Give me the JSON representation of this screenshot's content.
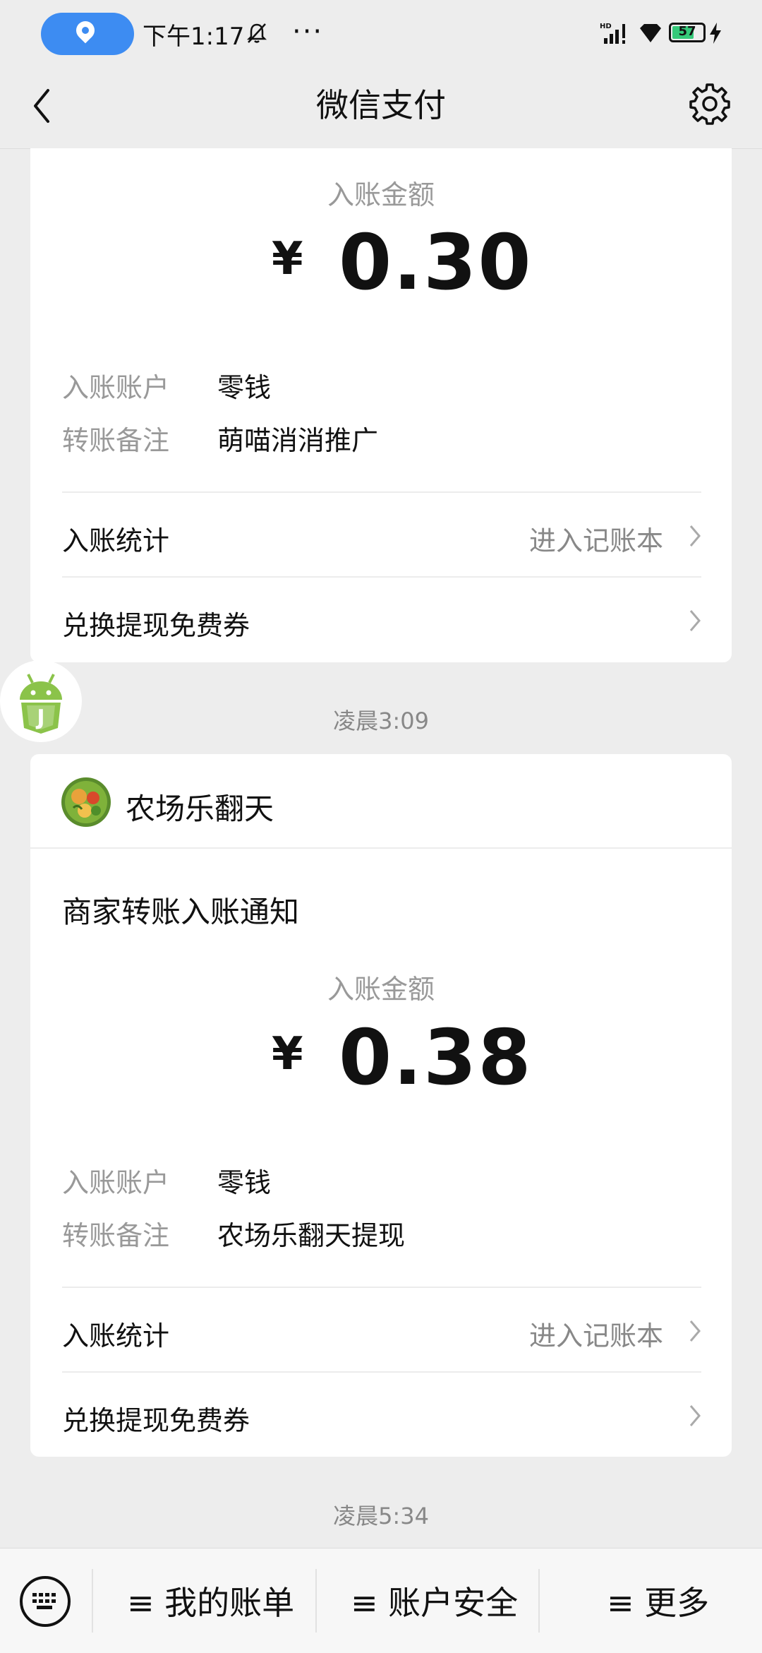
{
  "status_bar": {
    "time": "下午1:17",
    "more": "···",
    "battery": "57"
  },
  "nav": {
    "title": "微信支付"
  },
  "card1": {
    "amount_label": "入账金额",
    "currency": "¥",
    "amount": "0.30",
    "account_label": "入账账户",
    "account_value": "零钱",
    "remark_label": "转账备注",
    "remark_value": "萌喵消消推广",
    "stats_label": "入账统计",
    "stats_link": "进入记账本",
    "coupon_label": "兑换提现免费券"
  },
  "timestamp1": "凌晨3:09",
  "card2": {
    "merchant": "农场乐翻天",
    "notice": "商家转账入账通知",
    "amount_label": "入账金额",
    "currency": "¥",
    "amount": "0.38",
    "account_label": "入账账户",
    "account_value": "零钱",
    "remark_label": "转账备注",
    "remark_value": "农场乐翻天提现",
    "stats_label": "入账统计",
    "stats_link": "进入记账本",
    "coupon_label": "兑换提现免费券"
  },
  "timestamp2": "凌晨5:34",
  "bottom_menu": {
    "bills": "≡ 我的账单",
    "security": "≡ 账户安全",
    "more": "≡ 更多"
  },
  "colors": {
    "location_pill": "#3d8cf2",
    "battery_fill": "#35c979",
    "background": "#ededed"
  }
}
